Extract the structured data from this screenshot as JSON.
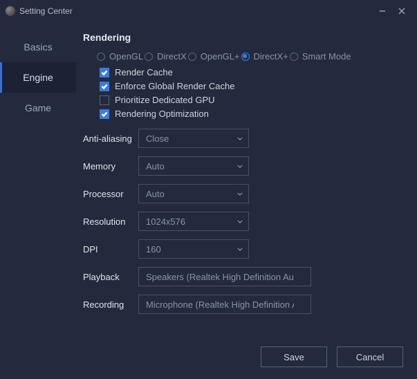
{
  "window": {
    "title": "Setting Center"
  },
  "sidebar": {
    "items": [
      {
        "label": "Basics"
      },
      {
        "label": "Engine"
      },
      {
        "label": "Game"
      }
    ],
    "activeIndex": 1
  },
  "rendering": {
    "title": "Rendering",
    "radios": [
      {
        "label": "OpenGL"
      },
      {
        "label": "DirectX"
      },
      {
        "label": "OpenGL+"
      },
      {
        "label": "DirectX+"
      },
      {
        "label": "Smart Mode"
      }
    ],
    "selectedRadio": 3,
    "checks": [
      {
        "label": "Render Cache",
        "checked": true
      },
      {
        "label": "Enforce Global Render Cache",
        "checked": true
      },
      {
        "label": "Prioritize Dedicated GPU",
        "checked": false
      },
      {
        "label": "Rendering Optimization",
        "checked": true
      }
    ]
  },
  "fields": {
    "antialias": {
      "label": "Anti-aliasing",
      "value": "Close"
    },
    "memory": {
      "label": "Memory",
      "value": "Auto"
    },
    "processor": {
      "label": "Processor",
      "value": "Auto"
    },
    "resolution": {
      "label": "Resolution",
      "value": "1024x576"
    },
    "dpi": {
      "label": "DPI",
      "value": "160"
    },
    "playback": {
      "label": "Playback",
      "value": "Speakers (Realtek High Definition Audio)"
    },
    "recording": {
      "label": "Recording",
      "value": "Microphone (Realtek High Definition Audio)"
    }
  },
  "footer": {
    "save": "Save",
    "cancel": "Cancel"
  }
}
